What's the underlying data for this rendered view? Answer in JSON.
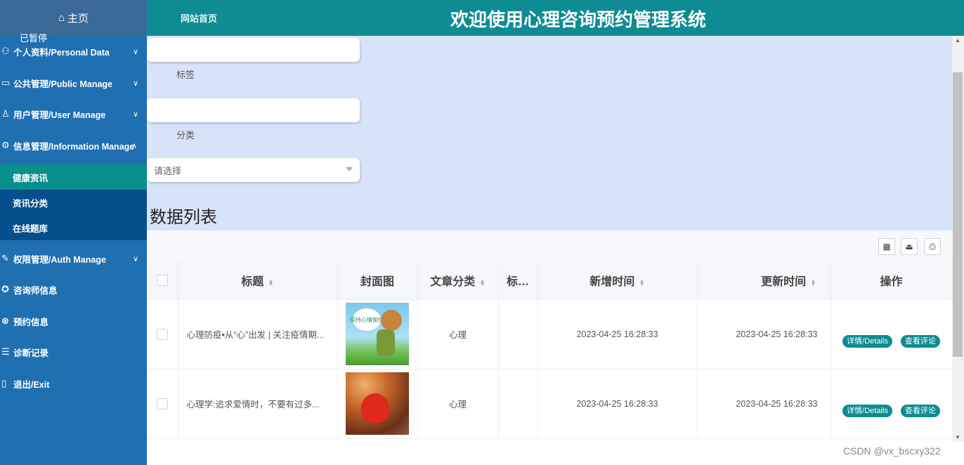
{
  "sidebar": {
    "home_label": "主页",
    "paused_label": "已暂停",
    "menu": [
      {
        "label": "个人资料/Personal Data",
        "icon": "user-card-icon"
      },
      {
        "label": "公共管理/Public Manage",
        "icon": "monitor-icon"
      },
      {
        "label": "用户管理/User Manage",
        "icon": "user-icon"
      },
      {
        "label": "信息管理/Information Manage",
        "icon": "info-icon"
      },
      {
        "label": "权限管理/Auth Manage",
        "icon": "pencil-icon"
      },
      {
        "label": "咨询师信息",
        "icon": "badge-icon"
      },
      {
        "label": "预约信息",
        "icon": "calendar-icon"
      },
      {
        "label": "诊断记录",
        "icon": "record-icon"
      },
      {
        "label": "退出/Exit",
        "icon": "exit-icon"
      }
    ],
    "submenu": [
      {
        "label": "健康资讯",
        "active": true
      },
      {
        "label": "资讯分类",
        "active": false
      },
      {
        "label": "在线题库",
        "active": false
      }
    ]
  },
  "header": {
    "home_link": "网站首页",
    "title": "欢迎使用心理咨询预约管理系统"
  },
  "filters": {
    "tag_label": "标签",
    "category_label": "分类",
    "select_placeholder": "请选择",
    "list_title": "数据列表"
  },
  "table": {
    "columns": [
      "标题",
      "封面图",
      "文章分类",
      "标…",
      "新增时间",
      "更新时间",
      "操作"
    ],
    "rows": [
      {
        "title": "心理防疫•从“心”出发 | 关注疫情期...",
        "category": "心理",
        "tag": "",
        "created": "2023-04-25 16:28:33",
        "updated": "2023-04-25 16:28:33"
      },
      {
        "title": "心理学:追求爱情时，不要有过多...",
        "category": "心理",
        "tag": "",
        "created": "2023-04-25 16:28:33",
        "updated": "2023-04-25 16:28:33"
      }
    ],
    "details_label": "详情/Details",
    "comments_label": "查看评论",
    "cover1_text": "保持心情愉快"
  },
  "watermark": "CSDN @vx_bscxy322"
}
